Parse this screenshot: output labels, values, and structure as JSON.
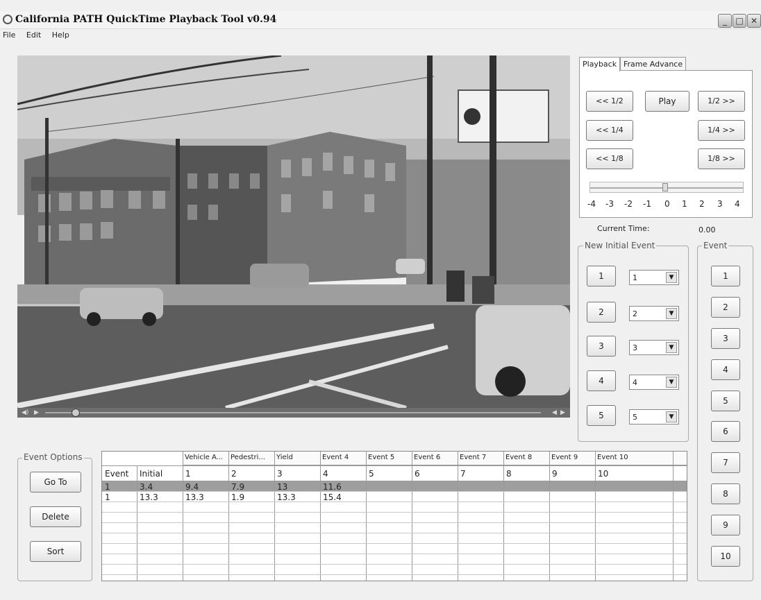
{
  "window": {
    "title": "California PATH QuickTime Playback Tool v0.94"
  },
  "menu": [
    "File",
    "Edit",
    "Help"
  ],
  "playback": {
    "tabs": [
      "Playback",
      "Frame Advance"
    ],
    "buttons": {
      "back_half": "<< 1/2",
      "play": "Play",
      "fwd_half": "1/2 >>",
      "back_quarter": "<< 1/4",
      "fwd_quarter": "1/4 >>",
      "back_eighth": "<< 1/8",
      "fwd_eighth": "1/8 >>"
    },
    "scale_labels": [
      "-4",
      "-3",
      "-2",
      "-1",
      "0",
      "1",
      "2",
      "3",
      "4"
    ],
    "slider_value": 0,
    "current_time_label": "Current Time:",
    "current_time_value": "0.00"
  },
  "new_initial_event": {
    "label": "New Initial Event",
    "rows": [
      {
        "button": "1",
        "combo": "1"
      },
      {
        "button": "2",
        "combo": "2"
      },
      {
        "button": "3",
        "combo": "3"
      },
      {
        "button": "4",
        "combo": "4"
      },
      {
        "button": "5",
        "combo": "5"
      }
    ]
  },
  "event_group": {
    "label": "Event",
    "buttons": [
      "1",
      "2",
      "3",
      "4",
      "5",
      "6",
      "7",
      "8",
      "9",
      "10"
    ]
  },
  "event_options": {
    "label": "Event Options",
    "goto": "Go To",
    "delete": "Delete",
    "sort": "Sort"
  },
  "table": {
    "top_headers": [
      "",
      "",
      "Vehicle A...",
      "Pedestri...",
      "Yield",
      "Event 4",
      "Event 5",
      "Event 6",
      "Event 7",
      "Event 8",
      "Event 9",
      "Event 10"
    ],
    "header_row": [
      "Event",
      "Initial",
      "1",
      "2",
      "3",
      "4",
      "5",
      "6",
      "7",
      "8",
      "9",
      "10"
    ],
    "rows": [
      [
        "1",
        "3.4",
        "9.4",
        "7.9",
        "13",
        "11.6",
        "",
        "",
        "",
        "",
        "",
        ""
      ],
      [
        "1",
        "13.3",
        "13.3",
        "1.9",
        "13.3",
        "15.4",
        "",
        "",
        "",
        "",
        "",
        ""
      ]
    ]
  }
}
